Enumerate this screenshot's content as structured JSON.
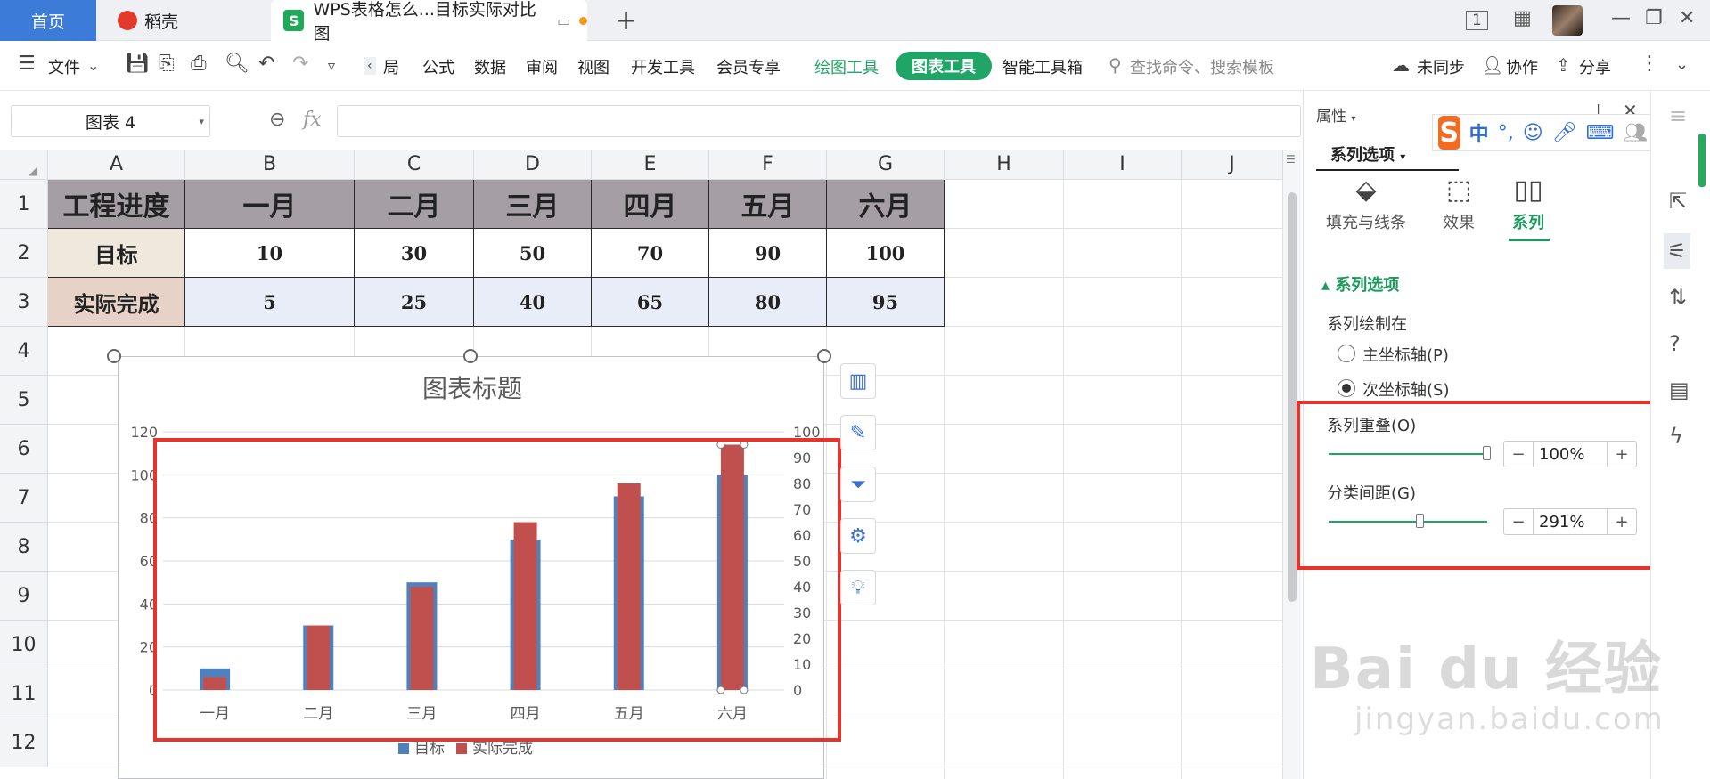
{
  "tabs": {
    "home": "首页",
    "docer": "稻壳",
    "doc": "WPS表格怎么...目标实际对比图",
    "add": "+"
  },
  "window": {
    "page_indicator": "1"
  },
  "menu": {
    "file": "文件",
    "layout_partial": "局",
    "formula": "公式",
    "data": "数据",
    "review": "审阅",
    "view": "视图",
    "devtools": "开发工具",
    "member": "会员专享",
    "draw_tools": "绘图工具",
    "chart_tools": "图表工具",
    "smart_toolbox": "智能工具箱",
    "search_placeholder": "查找命令、搜索模板",
    "unsynced": "未同步",
    "collab": "协作",
    "share": "分享"
  },
  "formula_bar": {
    "name_box": "图表 4",
    "fx": "fx"
  },
  "columns": [
    "A",
    "B",
    "C",
    "D",
    "E",
    "F",
    "G",
    "H",
    "I",
    "J"
  ],
  "rows": [
    "1",
    "2",
    "3",
    "4",
    "5",
    "6",
    "7",
    "8",
    "9",
    "10",
    "11",
    "12"
  ],
  "table": {
    "header": [
      "工程进度",
      "一月",
      "二月",
      "三月",
      "四月",
      "五月",
      "六月"
    ],
    "target": [
      "目标",
      "10",
      "30",
      "50",
      "70",
      "90",
      "100"
    ],
    "actual": [
      "实际完成",
      "5",
      "25",
      "40",
      "65",
      "80",
      "95"
    ]
  },
  "chart_data": {
    "type": "bar",
    "title": "图表标题",
    "categories": [
      "一月",
      "二月",
      "三月",
      "四月",
      "五月",
      "六月"
    ],
    "series": [
      {
        "name": "目标",
        "axis": "primary",
        "values": [
          10,
          30,
          50,
          70,
          90,
          100
        ],
        "color": "#4f81bd"
      },
      {
        "name": "实际完成",
        "axis": "secondary",
        "values": [
          5,
          25,
          40,
          65,
          80,
          95
        ],
        "color": "#c0504d"
      }
    ],
    "y_primary": {
      "ylim": [
        0,
        120
      ],
      "ticks": [
        0,
        20,
        40,
        60,
        80,
        100,
        120
      ]
    },
    "y_secondary": {
      "ylim": [
        0,
        100
      ],
      "ticks": [
        0,
        10,
        20,
        30,
        40,
        50,
        60,
        70,
        80,
        90,
        100
      ]
    },
    "grid": true,
    "legend": "bottom"
  },
  "panel": {
    "title": "属性",
    "tab": "系列选项",
    "tabs": [
      "填充与线条",
      "效果",
      "系列"
    ],
    "section": "系列选项",
    "plot_on": "系列绘制在",
    "primary_axis": "主坐标轴(P)",
    "secondary_axis": "次坐标轴(S)",
    "overlap_label": "系列重叠(O)",
    "overlap_value": "100%",
    "overlap_fraction": 1.0,
    "gap_label": "分类间距(G)",
    "gap_value": "291%",
    "gap_fraction": 0.58
  },
  "ime": {
    "logo": "S",
    "mode": "中"
  },
  "colors": {
    "accent_green": "#1fa565",
    "highlight_red": "#e8322a",
    "tab_blue": "#3d7bd9"
  },
  "watermark": {
    "main": "Bai du 经验",
    "sub": "jingyan.baidu.com"
  }
}
